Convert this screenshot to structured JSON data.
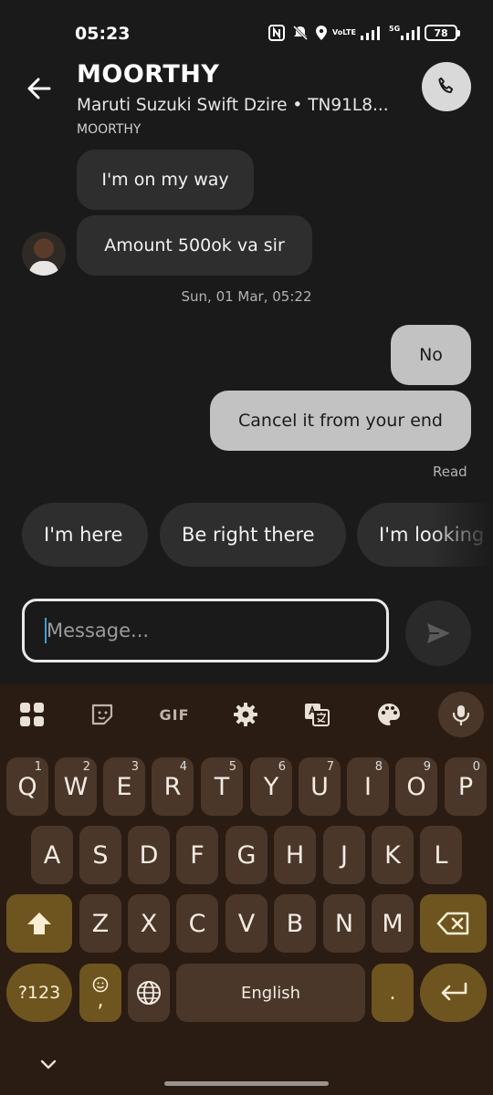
{
  "status_bar": {
    "time": "05:23",
    "network_label": "VoLTE",
    "signal_label": "5G",
    "battery": "78"
  },
  "header": {
    "title": "MOORTHY",
    "subtitle": "Maruti Suzuki Swift Dzire • TN91L8...",
    "overflow_text": "MOORTHY"
  },
  "messages": {
    "incoming": [
      "I'm on my way",
      "Amount 500ok va sir"
    ],
    "timestamp": "Sun, 01 Mar, 05:22",
    "outgoing": [
      "No",
      "Cancel it from your end"
    ],
    "read_status": "Read"
  },
  "quick_replies": [
    "I'm here",
    "Be right there",
    "I'm looking"
  ],
  "composer": {
    "placeholder": "Message..."
  },
  "keyboard": {
    "gif_label": "GIF",
    "row1": [
      "Q",
      "W",
      "E",
      "R",
      "T",
      "Y",
      "U",
      "I",
      "O",
      "P"
    ],
    "row1_hints": [
      "1",
      "2",
      "3",
      "4",
      "5",
      "6",
      "7",
      "8",
      "9",
      "0"
    ],
    "row2": [
      "A",
      "S",
      "D",
      "F",
      "G",
      "H",
      "J",
      "K",
      "L"
    ],
    "row3": [
      "Z",
      "X",
      "C",
      "V",
      "B",
      "N",
      "M"
    ],
    "symbols_label": "?123",
    "comma_label": ",",
    "space_label": "English",
    "period_label": "."
  },
  "colors": {
    "keyboard_bg": "#2a1c12",
    "key_bg": "#4a3729",
    "special_key_bg": "#6e551f",
    "chat_bg": "#1a1a1a"
  }
}
